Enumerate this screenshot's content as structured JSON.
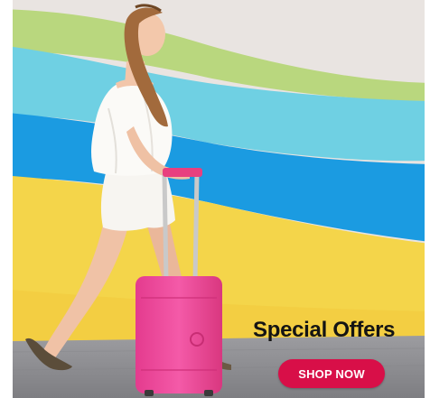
{
  "banner": {
    "headline": "Special Offers",
    "cta_label": "SHOP NOW"
  },
  "colors": {
    "cta_background": "#d80f48",
    "headline_text": "#141414",
    "suitcase": "#f0479c",
    "stripe_green": "#b9d77e",
    "stripe_cyan": "#6fd0e3",
    "stripe_blue": "#1b9be1",
    "stripe_yellow": "#f4d54a",
    "wall": "#e9e4e1",
    "floor": "#8f8f93"
  }
}
